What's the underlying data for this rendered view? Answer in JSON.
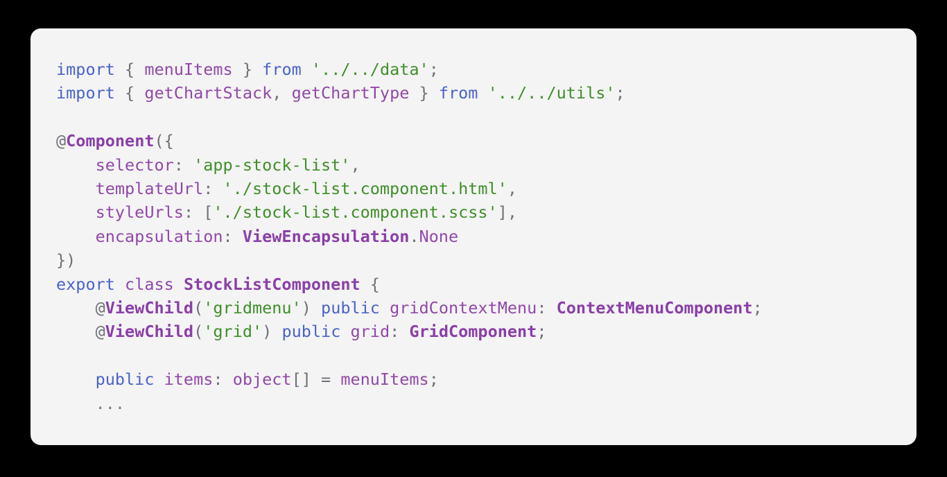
{
  "window": {
    "background_color": "#000000",
    "card_background_color": "#f4f4f4",
    "card_radius": "15px"
  },
  "theme": {
    "keyword_color": "#4a63c8",
    "class_keyword_color": "#9148a8",
    "type_color": "#8a3fa8",
    "identifier_color": "#9148a8",
    "string_color": "#3f8f29",
    "punctuation_color": "#6f6f78",
    "plain_color": "#555560"
  },
  "code": {
    "language": "typescript",
    "lines": [
      {
        "tokens": [
          {
            "t": "import",
            "k": "keyword"
          },
          {
            "t": " ",
            "k": "plain"
          },
          {
            "t": "{",
            "k": "punct"
          },
          {
            "t": " ",
            "k": "plain"
          },
          {
            "t": "menuItems",
            "k": "ident"
          },
          {
            "t": " ",
            "k": "plain"
          },
          {
            "t": "}",
            "k": "punct"
          },
          {
            "t": " ",
            "k": "plain"
          },
          {
            "t": "from",
            "k": "keyword"
          },
          {
            "t": " ",
            "k": "plain"
          },
          {
            "t": "'../../data'",
            "k": "string"
          },
          {
            "t": ";",
            "k": "punct"
          }
        ]
      },
      {
        "tokens": [
          {
            "t": "import",
            "k": "keyword"
          },
          {
            "t": " ",
            "k": "plain"
          },
          {
            "t": "{",
            "k": "punct"
          },
          {
            "t": " ",
            "k": "plain"
          },
          {
            "t": "getChartStack",
            "k": "ident"
          },
          {
            "t": ", ",
            "k": "punct"
          },
          {
            "t": "getChartType",
            "k": "ident"
          },
          {
            "t": " ",
            "k": "plain"
          },
          {
            "t": "}",
            "k": "punct"
          },
          {
            "t": " ",
            "k": "plain"
          },
          {
            "t": "from",
            "k": "keyword"
          },
          {
            "t": " ",
            "k": "plain"
          },
          {
            "t": "'../../utils'",
            "k": "string"
          },
          {
            "t": ";",
            "k": "punct"
          }
        ]
      },
      {
        "tokens": []
      },
      {
        "tokens": [
          {
            "t": "@",
            "k": "at"
          },
          {
            "t": "Component",
            "k": "type"
          },
          {
            "t": "({",
            "k": "punct"
          }
        ]
      },
      {
        "tokens": [
          {
            "t": "    ",
            "k": "plain"
          },
          {
            "t": "selector",
            "k": "ident"
          },
          {
            "t": ": ",
            "k": "punct"
          },
          {
            "t": "'app-stock-list'",
            "k": "string"
          },
          {
            "t": ",",
            "k": "punct"
          }
        ]
      },
      {
        "tokens": [
          {
            "t": "    ",
            "k": "plain"
          },
          {
            "t": "templateUrl",
            "k": "ident"
          },
          {
            "t": ": ",
            "k": "punct"
          },
          {
            "t": "'./stock-list.component.html'",
            "k": "string"
          },
          {
            "t": ",",
            "k": "punct"
          }
        ]
      },
      {
        "tokens": [
          {
            "t": "    ",
            "k": "plain"
          },
          {
            "t": "styleUrls",
            "k": "ident"
          },
          {
            "t": ": ",
            "k": "punct"
          },
          {
            "t": "[",
            "k": "punct"
          },
          {
            "t": "'./stock-list.component.scss'",
            "k": "string"
          },
          {
            "t": "],",
            "k": "punct"
          }
        ]
      },
      {
        "tokens": [
          {
            "t": "    ",
            "k": "plain"
          },
          {
            "t": "encapsulation",
            "k": "ident"
          },
          {
            "t": ": ",
            "k": "punct"
          },
          {
            "t": "ViewEncapsulation",
            "k": "type"
          },
          {
            "t": ".",
            "k": "punct"
          },
          {
            "t": "None",
            "k": "ident"
          }
        ]
      },
      {
        "tokens": [
          {
            "t": "})",
            "k": "punct"
          }
        ]
      },
      {
        "tokens": [
          {
            "t": "export",
            "k": "keyword"
          },
          {
            "t": " ",
            "k": "plain"
          },
          {
            "t": "class",
            "k": "class-kw"
          },
          {
            "t": " ",
            "k": "plain"
          },
          {
            "t": "StockListComponent",
            "k": "type"
          },
          {
            "t": " ",
            "k": "plain"
          },
          {
            "t": "{",
            "k": "punct"
          }
        ]
      },
      {
        "tokens": [
          {
            "t": "    ",
            "k": "plain"
          },
          {
            "t": "@",
            "k": "at"
          },
          {
            "t": "ViewChild",
            "k": "type"
          },
          {
            "t": "(",
            "k": "punct"
          },
          {
            "t": "'gridmenu'",
            "k": "string"
          },
          {
            "t": ")",
            "k": "punct"
          },
          {
            "t": " ",
            "k": "plain"
          },
          {
            "t": "public",
            "k": "keyword"
          },
          {
            "t": " ",
            "k": "plain"
          },
          {
            "t": "gridContextMenu",
            "k": "ident"
          },
          {
            "t": ": ",
            "k": "punct"
          },
          {
            "t": "ContextMenuComponent",
            "k": "type"
          },
          {
            "t": ";",
            "k": "punct"
          }
        ]
      },
      {
        "tokens": [
          {
            "t": "    ",
            "k": "plain"
          },
          {
            "t": "@",
            "k": "at"
          },
          {
            "t": "ViewChild",
            "k": "type"
          },
          {
            "t": "(",
            "k": "punct"
          },
          {
            "t": "'grid'",
            "k": "string"
          },
          {
            "t": ")",
            "k": "punct"
          },
          {
            "t": " ",
            "k": "plain"
          },
          {
            "t": "public",
            "k": "keyword"
          },
          {
            "t": " ",
            "k": "plain"
          },
          {
            "t": "grid",
            "k": "ident"
          },
          {
            "t": ": ",
            "k": "punct"
          },
          {
            "t": "GridComponent",
            "k": "type"
          },
          {
            "t": ";",
            "k": "punct"
          }
        ]
      },
      {
        "tokens": []
      },
      {
        "tokens": [
          {
            "t": "    ",
            "k": "plain"
          },
          {
            "t": "public",
            "k": "keyword"
          },
          {
            "t": " ",
            "k": "plain"
          },
          {
            "t": "items",
            "k": "ident"
          },
          {
            "t": ": ",
            "k": "punct"
          },
          {
            "t": "object",
            "k": "ident"
          },
          {
            "t": "[]",
            "k": "punct"
          },
          {
            "t": " ",
            "k": "plain"
          },
          {
            "t": "=",
            "k": "punct"
          },
          {
            "t": " ",
            "k": "plain"
          },
          {
            "t": "menuItems",
            "k": "ident"
          },
          {
            "t": ";",
            "k": "punct"
          }
        ]
      },
      {
        "tokens": [
          {
            "t": "    ",
            "k": "plain"
          },
          {
            "t": "...",
            "k": "dots"
          }
        ]
      }
    ]
  }
}
